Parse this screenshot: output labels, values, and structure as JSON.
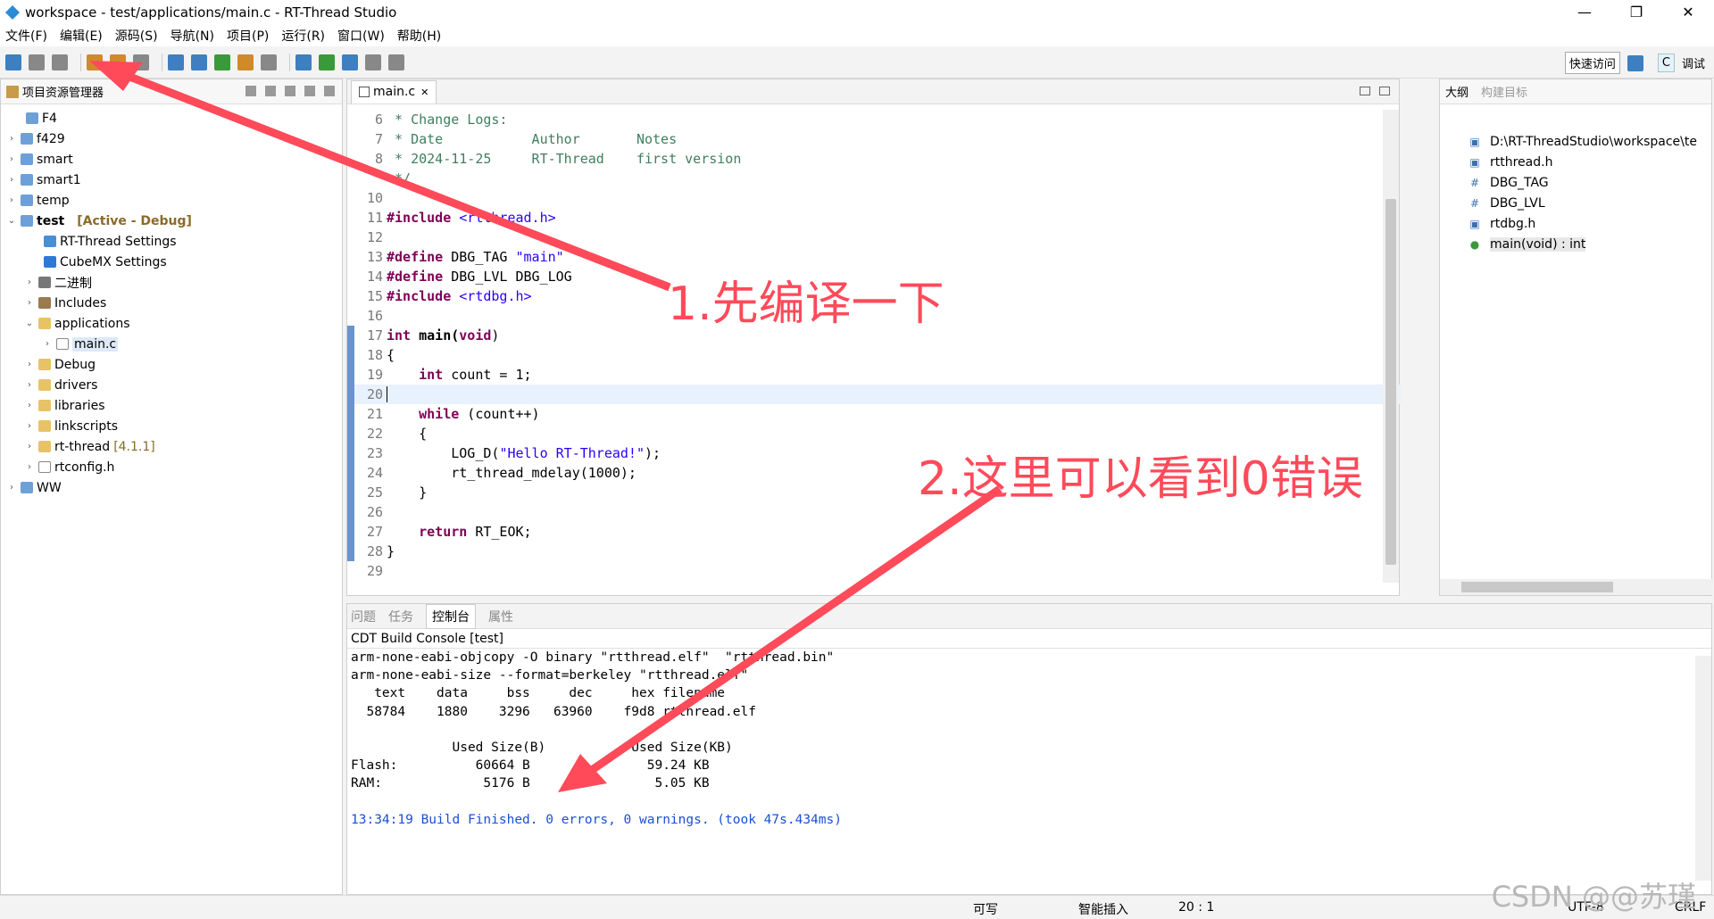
{
  "window": {
    "title": "workspace - test/applications/main.c - RT-Thread Studio",
    "min": "—",
    "max": "❐",
    "close": "✕"
  },
  "menu": [
    "文件(F)",
    "编辑(E)",
    "源码(S)",
    "导航(N)",
    "项目(P)",
    "运行(R)",
    "窗口(W)",
    "帮助(H)"
  ],
  "toolbar": {
    "quick_access": "快速访问",
    "perspective_c": "C",
    "perspective_debug": "调试"
  },
  "project_explorer": {
    "tab_label": "项目资源管理器",
    "items": [
      {
        "label": "F4"
      },
      {
        "label": "f429"
      },
      {
        "label": "smart"
      },
      {
        "label": "smart1"
      },
      {
        "label": "temp"
      },
      {
        "label": "test",
        "status": "[Active - Debug]"
      },
      {
        "label": "RT-Thread Settings"
      },
      {
        "label": "CubeMX Settings"
      },
      {
        "label": "二进制"
      },
      {
        "label": "Includes"
      },
      {
        "label": "applications"
      },
      {
        "label": "main.c"
      },
      {
        "label": "Debug"
      },
      {
        "label": "drivers"
      },
      {
        "label": "libraries"
      },
      {
        "label": "linkscripts"
      },
      {
        "label": "rt-thread",
        "version": "[4.1.1]"
      },
      {
        "label": "rtconfig.h"
      },
      {
        "label": "WW"
      }
    ]
  },
  "editor": {
    "tab_label": "main.c",
    "line_numbers": [
      "6",
      "7",
      "8",
      "",
      "10",
      "11",
      "12",
      "13",
      "14",
      "15",
      "16",
      "17",
      "18",
      "19",
      "20",
      "21",
      "22",
      "23",
      "24",
      "25",
      "26",
      "27",
      "28",
      "29"
    ],
    "code": {
      "l6": " * Change Logs:",
      "l7": " * Date           Author       Notes",
      "l8": " * 2024-11-25     RT-Thread    first version",
      "l9": " */",
      "l11a": "#include",
      "l11b": " <rtthread.h>",
      "l13a": "#define",
      "l13b": " DBG_TAG ",
      "l13c": "\"main\"",
      "l14a": "#define",
      "l14b": " DBG_LVL DBG_LOG",
      "l15a": "#include",
      "l15b": " <rtdbg.h>",
      "l17a": "int",
      "l17b": " main(",
      "l17c": "void",
      "l17d": ")",
      "l18": "{",
      "l19a": "    int",
      "l19b": " count = 1;",
      "l21a": "    while",
      "l21b": " (count++)",
      "l22": "    {",
      "l23a": "        LOG_D(",
      "l23b": "\"Hello RT-Thread!\"",
      "l23c": ");",
      "l24": "        rt_thread_mdelay(1000);",
      "l25": "    }",
      "l27a": "    return",
      "l27b": " RT_EOK;",
      "l28": "}"
    }
  },
  "outline": {
    "tab_outline": "大纲",
    "tab_build": "构建目标",
    "items": [
      {
        "icon": "▣",
        "label": "D:\\RT-ThreadStudio\\workspace\\te"
      },
      {
        "icon": "▣",
        "label": "rtthread.h"
      },
      {
        "icon": "#",
        "label": "DBG_TAG"
      },
      {
        "icon": "#",
        "label": "DBG_LVL"
      },
      {
        "icon": "▣",
        "label": "rtdbg.h"
      },
      {
        "icon": "●",
        "label": "main(void) : int"
      }
    ]
  },
  "console": {
    "tabs": [
      "问题",
      "任务",
      "控制台",
      "属性"
    ],
    "title": "CDT Build Console [test]",
    "lines": [
      "arm-none-eabi-objcopy -O binary \"rtthread.elf\"  \"rtthread.bin\"",
      "arm-none-eabi-size --format=berkeley \"rtthread.elf\"",
      "   text    data     bss     dec     hex filename",
      "  58784    1880    3296   63960    f9d8 rtthread.elf",
      "",
      "             Used Size(B)           Used Size(KB)",
      "Flash:          60664 B               59.24 KB",
      "RAM:             5176 B                5.05 KB",
      ""
    ],
    "finish_line": "13:34:19 Build Finished. 0 errors, 0 warnings. (took 47s.434ms)"
  },
  "status_bar": {
    "writable": "可写",
    "insert_mode": "智能插入",
    "position": "20 : 1",
    "encoding": "UTF-8",
    "line_ending": "CRLF"
  },
  "annotations": {
    "step1": "1.先编译一下",
    "step2": "2.这里可以看到0错误",
    "watermark": "CSDN @@苏瑾"
  },
  "colors": {
    "annotation": "#ff4a5a",
    "keyword": "#7f0055",
    "string": "#2a00ff",
    "comment": "#3f7f5f"
  }
}
